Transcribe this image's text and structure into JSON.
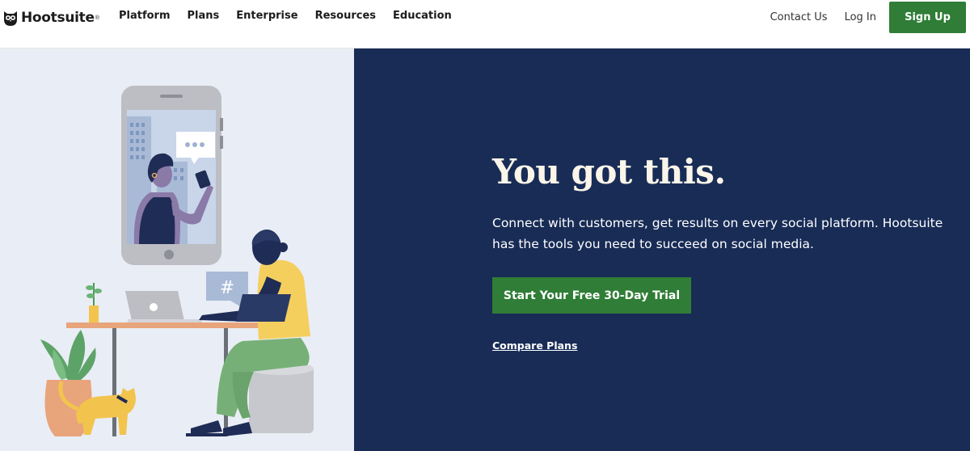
{
  "header": {
    "logo_text": "Hootsuite",
    "logo_mark": "®",
    "nav": [
      {
        "label": "Platform"
      },
      {
        "label": "Plans"
      },
      {
        "label": "Enterprise"
      },
      {
        "label": "Resources"
      },
      {
        "label": "Education"
      }
    ],
    "contact_label": "Contact Us",
    "login_label": "Log In",
    "signup_label": "Sign Up"
  },
  "hero": {
    "headline": "You got this.",
    "subtext": "Connect with customers, get results on every social platform. Hootsuite has the tools you need to succeed on social media.",
    "cta_label": "Start Your Free 30-Day Trial",
    "compare_label": "Compare Plans",
    "hashtag": "#"
  },
  "colors": {
    "brand_green": "#2f7d36",
    "hero_navy": "#182c56",
    "illustration_bg": "#e9edf5",
    "headline_cream": "#fbf5e9"
  },
  "icons": [
    "owl-logo-icon",
    "chat-bubble-icon",
    "hashtag-bubble-icon"
  ]
}
